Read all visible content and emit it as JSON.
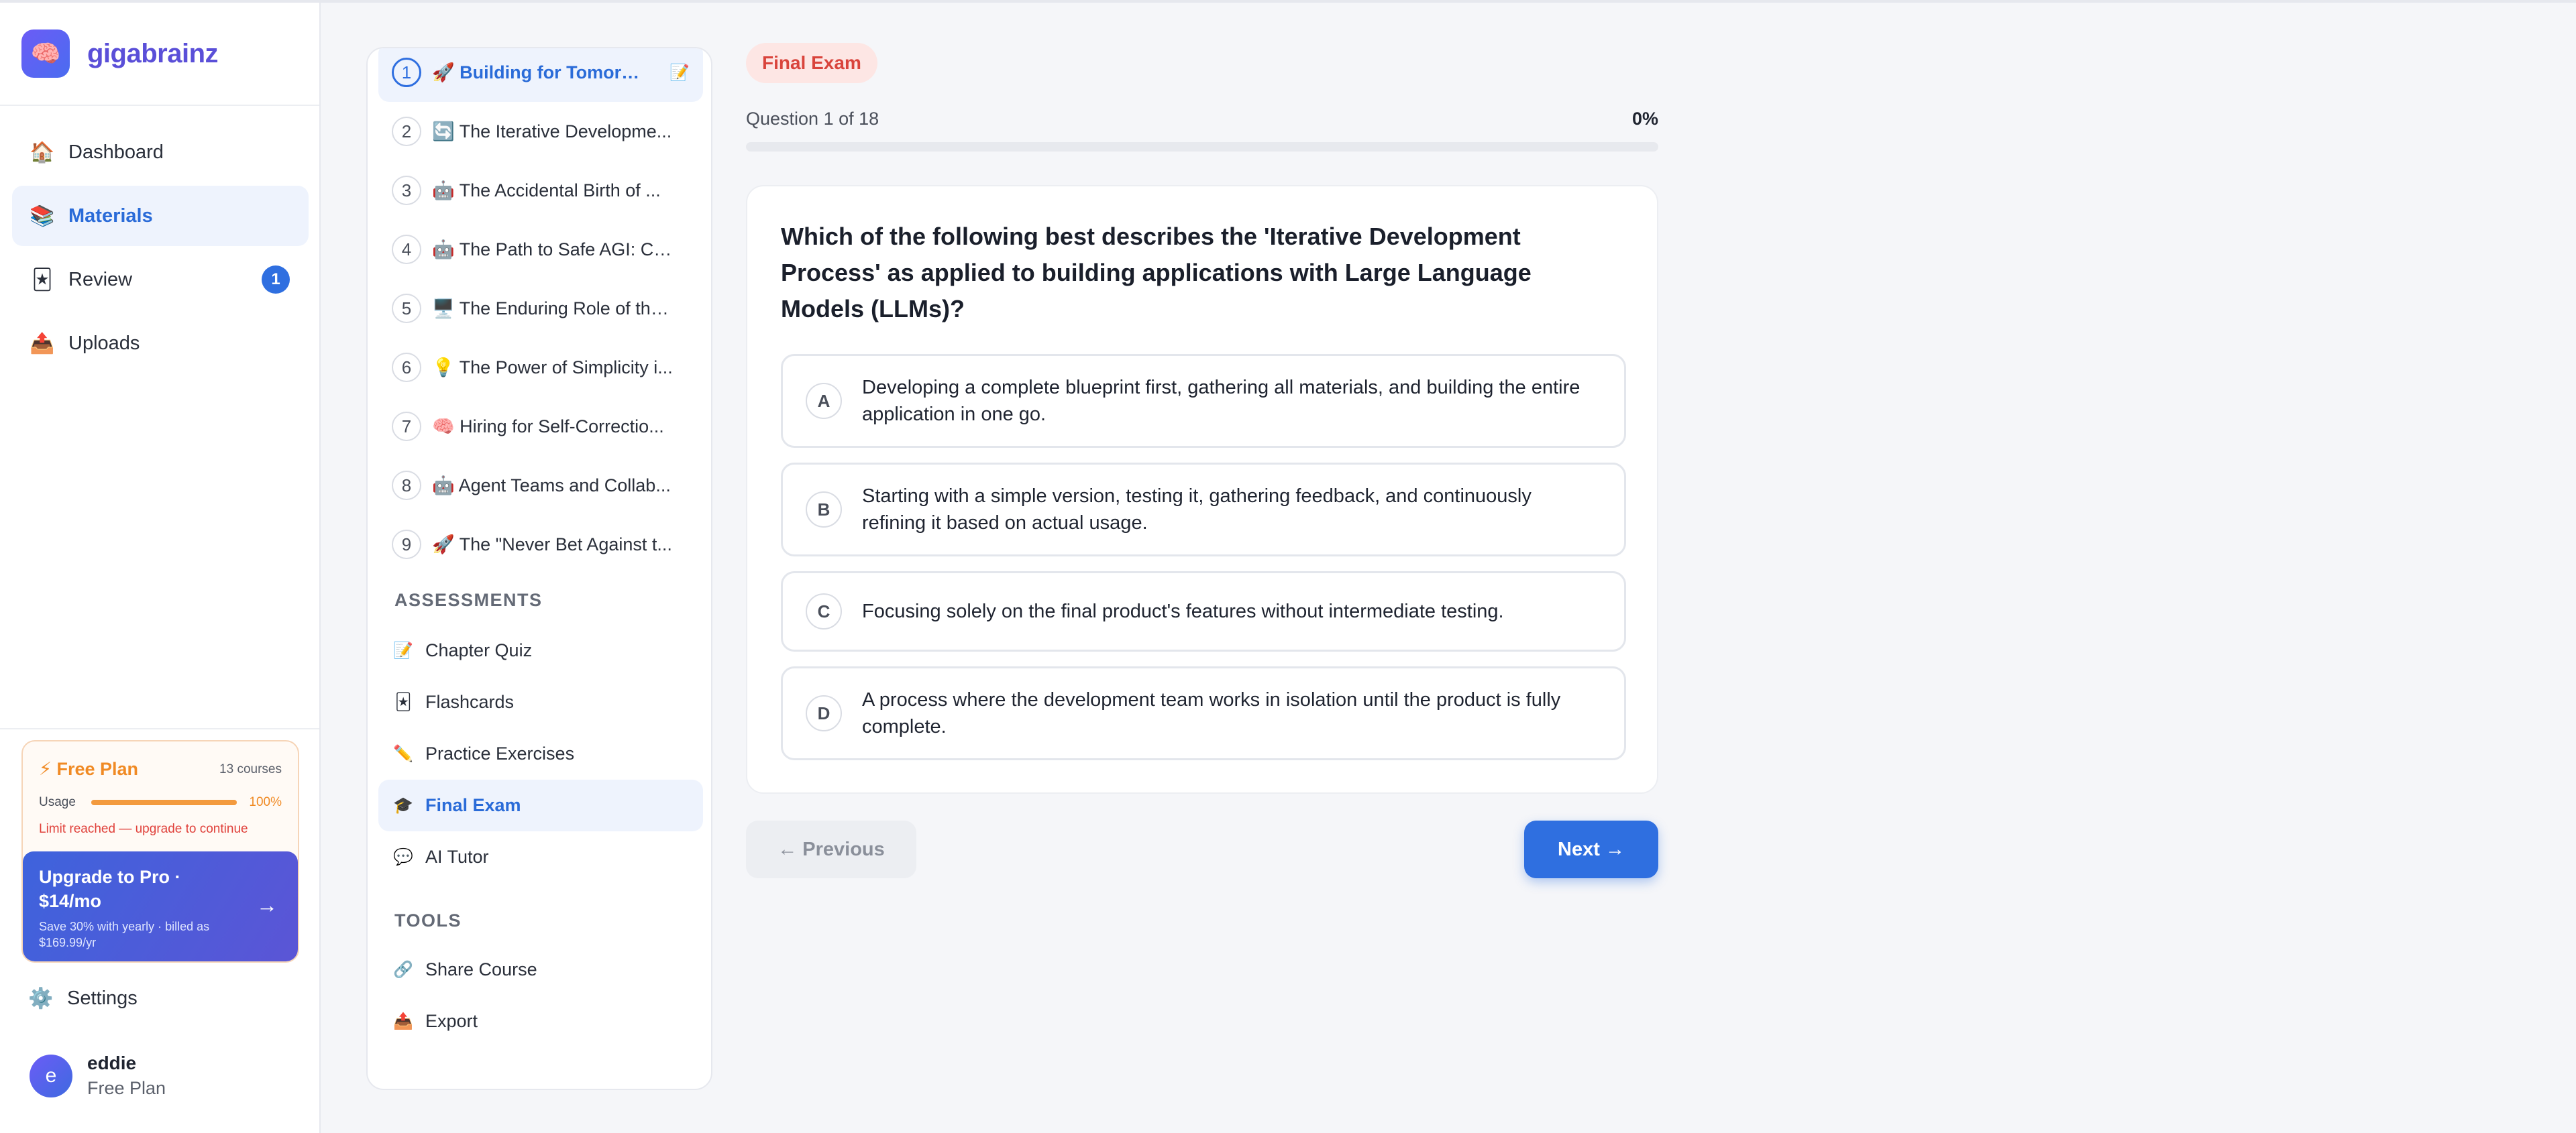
{
  "app": {
    "name": "gigabrainz",
    "logo_icon": "brain-icon"
  },
  "nav": {
    "items": [
      {
        "label": "Dashboard",
        "icon": "🏠",
        "active": false
      },
      {
        "label": "Materials",
        "icon": "📚",
        "active": true
      },
      {
        "label": "Review",
        "icon": "🃏",
        "active": false,
        "badge": "1"
      },
      {
        "label": "Uploads",
        "icon": "📤",
        "active": false
      }
    ]
  },
  "plan": {
    "name": "⚡ Free Plan",
    "courses": "13 courses",
    "usage_label": "Usage",
    "usage_pct": "100%",
    "usage_fraction": 1.0,
    "limit_text": "Limit reached — upgrade to continue",
    "upgrade_title": "Upgrade to Pro · $14/mo",
    "upgrade_sub": "Save 30% with yearly · billed as $169.99/yr",
    "upgrade_arrow": "→"
  },
  "settings": {
    "label": "Settings",
    "icon": "⚙️"
  },
  "user": {
    "initial": "e",
    "name": "eddie",
    "plan": "Free Plan"
  },
  "chapters": [
    {
      "num": "1",
      "title": "🚀 Building for Tomorr...",
      "active": true,
      "edit_icon": "📝"
    },
    {
      "num": "2",
      "title": "🔄 The Iterative Developme...",
      "active": false
    },
    {
      "num": "3",
      "title": "🤖 The Accidental Birth of ...",
      "active": false
    },
    {
      "num": "4",
      "title": "🤖 The Path to Safe AGI: Co...",
      "active": false
    },
    {
      "num": "5",
      "title": "🖥️ The Enduring Role of the...",
      "active": false
    },
    {
      "num": "6",
      "title": "💡 The Power of Simplicity i...",
      "active": false
    },
    {
      "num": "7",
      "title": "🧠 Hiring for Self-Correctio...",
      "active": false
    },
    {
      "num": "8",
      "title": "🤖 Agent Teams and Collab...",
      "active": false
    },
    {
      "num": "9",
      "title": "🚀 The \"Never Bet Against t...",
      "active": false
    }
  ],
  "assessments": {
    "heading": "ASSESSMENTS",
    "items": [
      {
        "label": "Chapter Quiz",
        "icon": "📝",
        "active": false
      },
      {
        "label": "Flashcards",
        "icon": "🃏",
        "active": false
      },
      {
        "label": "Practice Exercises",
        "icon": "✏️",
        "active": false
      },
      {
        "label": "Final Exam",
        "icon": "🎓",
        "active": true
      },
      {
        "label": "AI Tutor",
        "icon": "💬",
        "active": false
      }
    ]
  },
  "tools": {
    "heading": "TOOLS",
    "items": [
      {
        "label": "Share Course",
        "icon": "🔗"
      },
      {
        "label": "Export",
        "icon": "📤"
      }
    ]
  },
  "quiz": {
    "badge": "Final Exam",
    "count_text": "Question 1 of 18",
    "progress_pct": "0%",
    "progress_fraction": 0,
    "question": "Which of the following best describes the 'Iterative Development Process' as applied to building applications with Large Language Models (LLMs)?",
    "options": [
      {
        "letter": "A",
        "text": "Developing a complete blueprint first, gathering all materials, and building the entire application in one go."
      },
      {
        "letter": "B",
        "text": "Starting with a simple version, testing it, gathering feedback, and continuously refining it based on actual usage."
      },
      {
        "letter": "C",
        "text": "Focusing solely on the final product's features without intermediate testing."
      },
      {
        "letter": "D",
        "text": "A process where the development team works in isolation until the product is fully complete."
      }
    ],
    "prev_label": "← Previous",
    "next_label": "Next →"
  },
  "colors": {
    "accent": "#2f6fe0",
    "brand": "#5a4fd8",
    "plan_orange": "#f08a24",
    "danger": "#e0403a"
  }
}
